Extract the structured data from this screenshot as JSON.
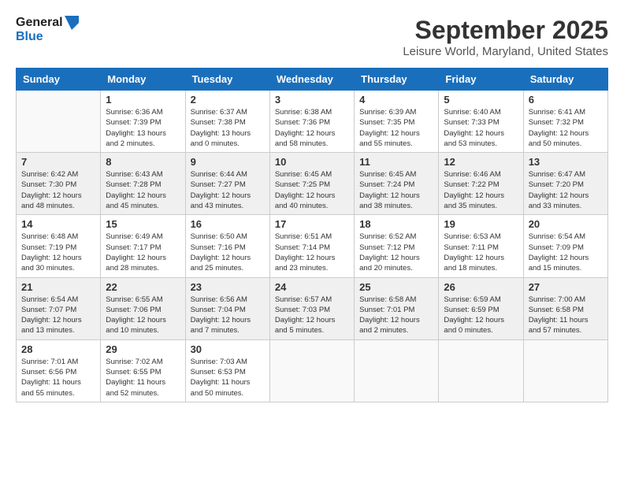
{
  "logo": {
    "line1": "General",
    "line2": "Blue"
  },
  "calendar_title": "September 2025",
  "subtitle": "Leisure World, Maryland, United States",
  "days_of_week": [
    "Sunday",
    "Monday",
    "Tuesday",
    "Wednesday",
    "Thursday",
    "Friday",
    "Saturday"
  ],
  "weeks": [
    {
      "shaded": false,
      "days": [
        {
          "num": "",
          "empty": true
        },
        {
          "num": "1",
          "sunrise": "6:36 AM",
          "sunset": "7:39 PM",
          "daylight": "13 hours and 2 minutes."
        },
        {
          "num": "2",
          "sunrise": "6:37 AM",
          "sunset": "7:38 PM",
          "daylight": "13 hours and 0 minutes."
        },
        {
          "num": "3",
          "sunrise": "6:38 AM",
          "sunset": "7:36 PM",
          "daylight": "12 hours and 58 minutes."
        },
        {
          "num": "4",
          "sunrise": "6:39 AM",
          "sunset": "7:35 PM",
          "daylight": "12 hours and 55 minutes."
        },
        {
          "num": "5",
          "sunrise": "6:40 AM",
          "sunset": "7:33 PM",
          "daylight": "12 hours and 53 minutes."
        },
        {
          "num": "6",
          "sunrise": "6:41 AM",
          "sunset": "7:32 PM",
          "daylight": "12 hours and 50 minutes."
        }
      ]
    },
    {
      "shaded": true,
      "days": [
        {
          "num": "7",
          "sunrise": "6:42 AM",
          "sunset": "7:30 PM",
          "daylight": "12 hours and 48 minutes."
        },
        {
          "num": "8",
          "sunrise": "6:43 AM",
          "sunset": "7:28 PM",
          "daylight": "12 hours and 45 minutes."
        },
        {
          "num": "9",
          "sunrise": "6:44 AM",
          "sunset": "7:27 PM",
          "daylight": "12 hours and 43 minutes."
        },
        {
          "num": "10",
          "sunrise": "6:45 AM",
          "sunset": "7:25 PM",
          "daylight": "12 hours and 40 minutes."
        },
        {
          "num": "11",
          "sunrise": "6:45 AM",
          "sunset": "7:24 PM",
          "daylight": "12 hours and 38 minutes."
        },
        {
          "num": "12",
          "sunrise": "6:46 AM",
          "sunset": "7:22 PM",
          "daylight": "12 hours and 35 minutes."
        },
        {
          "num": "13",
          "sunrise": "6:47 AM",
          "sunset": "7:20 PM",
          "daylight": "12 hours and 33 minutes."
        }
      ]
    },
    {
      "shaded": false,
      "days": [
        {
          "num": "14",
          "sunrise": "6:48 AM",
          "sunset": "7:19 PM",
          "daylight": "12 hours and 30 minutes."
        },
        {
          "num": "15",
          "sunrise": "6:49 AM",
          "sunset": "7:17 PM",
          "daylight": "12 hours and 28 minutes."
        },
        {
          "num": "16",
          "sunrise": "6:50 AM",
          "sunset": "7:16 PM",
          "daylight": "12 hours and 25 minutes."
        },
        {
          "num": "17",
          "sunrise": "6:51 AM",
          "sunset": "7:14 PM",
          "daylight": "12 hours and 23 minutes."
        },
        {
          "num": "18",
          "sunrise": "6:52 AM",
          "sunset": "7:12 PM",
          "daylight": "12 hours and 20 minutes."
        },
        {
          "num": "19",
          "sunrise": "6:53 AM",
          "sunset": "7:11 PM",
          "daylight": "12 hours and 18 minutes."
        },
        {
          "num": "20",
          "sunrise": "6:54 AM",
          "sunset": "7:09 PM",
          "daylight": "12 hours and 15 minutes."
        }
      ]
    },
    {
      "shaded": true,
      "days": [
        {
          "num": "21",
          "sunrise": "6:54 AM",
          "sunset": "7:07 PM",
          "daylight": "12 hours and 13 minutes."
        },
        {
          "num": "22",
          "sunrise": "6:55 AM",
          "sunset": "7:06 PM",
          "daylight": "12 hours and 10 minutes."
        },
        {
          "num": "23",
          "sunrise": "6:56 AM",
          "sunset": "7:04 PM",
          "daylight": "12 hours and 7 minutes."
        },
        {
          "num": "24",
          "sunrise": "6:57 AM",
          "sunset": "7:03 PM",
          "daylight": "12 hours and 5 minutes."
        },
        {
          "num": "25",
          "sunrise": "6:58 AM",
          "sunset": "7:01 PM",
          "daylight": "12 hours and 2 minutes."
        },
        {
          "num": "26",
          "sunrise": "6:59 AM",
          "sunset": "6:59 PM",
          "daylight": "12 hours and 0 minutes."
        },
        {
          "num": "27",
          "sunrise": "7:00 AM",
          "sunset": "6:58 PM",
          "daylight": "11 hours and 57 minutes."
        }
      ]
    },
    {
      "shaded": false,
      "days": [
        {
          "num": "28",
          "sunrise": "7:01 AM",
          "sunset": "6:56 PM",
          "daylight": "11 hours and 55 minutes."
        },
        {
          "num": "29",
          "sunrise": "7:02 AM",
          "sunset": "6:55 PM",
          "daylight": "11 hours and 52 minutes."
        },
        {
          "num": "30",
          "sunrise": "7:03 AM",
          "sunset": "6:53 PM",
          "daylight": "11 hours and 50 minutes."
        },
        {
          "num": "",
          "empty": true
        },
        {
          "num": "",
          "empty": true
        },
        {
          "num": "",
          "empty": true
        },
        {
          "num": "",
          "empty": true
        }
      ]
    }
  ]
}
